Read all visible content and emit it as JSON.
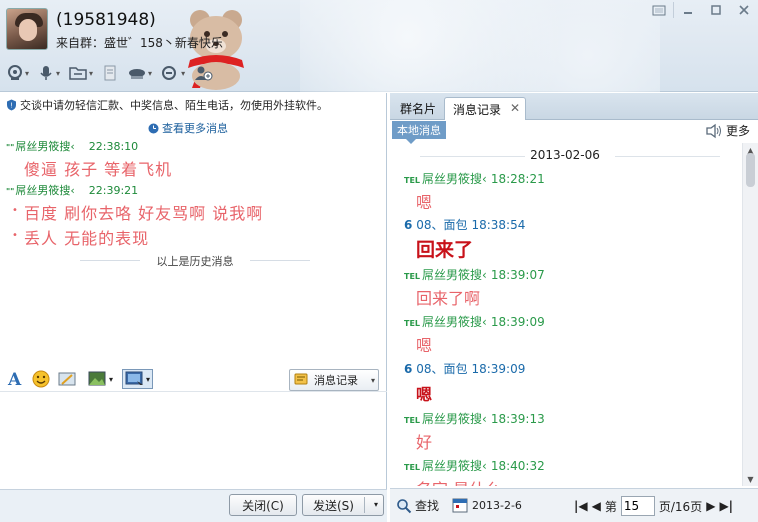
{
  "header": {
    "group_id": "(19581948)",
    "from_group": "来自群：盛世゛158丶新春快乐"
  },
  "notice": "交谈中请勿轻信汇款、中奖信息、陌生电话，勿使用外挂软件。",
  "more_messages": "查看更多消息",
  "history": [
    {
      "sender": "屌丝男筱搜‹",
      "time": "22:38:10",
      "lines": [
        "傻逼  孩子  等着飞机"
      ]
    },
    {
      "sender": "屌丝男筱搜‹",
      "time": "22:39:21",
      "lines": [
        "百度  刷你去咯  好友骂啊    说我啊",
        "丢人  无能的表现"
      ]
    }
  ],
  "history_end": "以上是历史消息",
  "input_toolbar": {
    "message_record": "消息记录"
  },
  "buttons": {
    "close": "关闭(C)",
    "send": "发送(S)"
  },
  "right_panel": {
    "tab_card": "群名片",
    "tab_record": "消息记录",
    "local_messages": "本地消息",
    "more": "更多",
    "date": "2013-02-06",
    "log": [
      {
        "tel": "TEL",
        "sender": "屌丝男筱搜‹",
        "time": "18:28:21",
        "msg": "嗯",
        "style": "normal"
      },
      {
        "prefix": "6",
        "sender": "08、面包",
        "time": "18:38:54",
        "msg": "回来了",
        "style": "big"
      },
      {
        "tel": "TEL",
        "sender": "屌丝男筱搜‹",
        "time": "18:39:07",
        "msg": "回来了啊",
        "style": "normal"
      },
      {
        "tel": "TEL",
        "sender": "屌丝男筱搜‹",
        "time": "18:39:09",
        "msg": "嗯",
        "style": "normal"
      },
      {
        "prefix": "6",
        "sender": "08、面包",
        "time": "18:39:09",
        "msg": "嗯",
        "style": "bold"
      },
      {
        "tel": "TEL",
        "sender": "屌丝男筱搜‹",
        "time": "18:39:13",
        "msg": "好",
        "style": "normal"
      },
      {
        "tel": "TEL",
        "sender": "屌丝男筱搜‹",
        "time": "18:40:32",
        "msg": "名字  是什么",
        "style": "normal"
      }
    ],
    "find": "查找",
    "date_picker": "2013-2-6",
    "page_prefix": "第",
    "page_current": "15",
    "page_suffix": "页/16页"
  },
  "colors": {
    "accent": "#6f9cc7",
    "history_text": "#e8646a",
    "bold_red": "#c8121a",
    "sender_green": "#2a9a4a"
  }
}
